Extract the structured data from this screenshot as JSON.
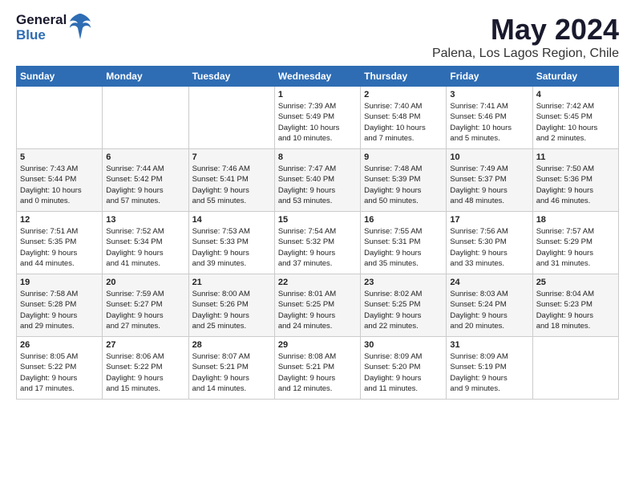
{
  "logo": {
    "line1": "General",
    "line2": "Blue"
  },
  "title": "May 2024",
  "subtitle": "Palena, Los Lagos Region, Chile",
  "days_header": [
    "Sunday",
    "Monday",
    "Tuesday",
    "Wednesday",
    "Thursday",
    "Friday",
    "Saturday"
  ],
  "weeks": [
    [
      {
        "day": "",
        "info": ""
      },
      {
        "day": "",
        "info": ""
      },
      {
        "day": "",
        "info": ""
      },
      {
        "day": "1",
        "info": "Sunrise: 7:39 AM\nSunset: 5:49 PM\nDaylight: 10 hours\nand 10 minutes."
      },
      {
        "day": "2",
        "info": "Sunrise: 7:40 AM\nSunset: 5:48 PM\nDaylight: 10 hours\nand 7 minutes."
      },
      {
        "day": "3",
        "info": "Sunrise: 7:41 AM\nSunset: 5:46 PM\nDaylight: 10 hours\nand 5 minutes."
      },
      {
        "day": "4",
        "info": "Sunrise: 7:42 AM\nSunset: 5:45 PM\nDaylight: 10 hours\nand 2 minutes."
      }
    ],
    [
      {
        "day": "5",
        "info": "Sunrise: 7:43 AM\nSunset: 5:44 PM\nDaylight: 10 hours\nand 0 minutes."
      },
      {
        "day": "6",
        "info": "Sunrise: 7:44 AM\nSunset: 5:42 PM\nDaylight: 9 hours\nand 57 minutes."
      },
      {
        "day": "7",
        "info": "Sunrise: 7:46 AM\nSunset: 5:41 PM\nDaylight: 9 hours\nand 55 minutes."
      },
      {
        "day": "8",
        "info": "Sunrise: 7:47 AM\nSunset: 5:40 PM\nDaylight: 9 hours\nand 53 minutes."
      },
      {
        "day": "9",
        "info": "Sunrise: 7:48 AM\nSunset: 5:39 PM\nDaylight: 9 hours\nand 50 minutes."
      },
      {
        "day": "10",
        "info": "Sunrise: 7:49 AM\nSunset: 5:37 PM\nDaylight: 9 hours\nand 48 minutes."
      },
      {
        "day": "11",
        "info": "Sunrise: 7:50 AM\nSunset: 5:36 PM\nDaylight: 9 hours\nand 46 minutes."
      }
    ],
    [
      {
        "day": "12",
        "info": "Sunrise: 7:51 AM\nSunset: 5:35 PM\nDaylight: 9 hours\nand 44 minutes."
      },
      {
        "day": "13",
        "info": "Sunrise: 7:52 AM\nSunset: 5:34 PM\nDaylight: 9 hours\nand 41 minutes."
      },
      {
        "day": "14",
        "info": "Sunrise: 7:53 AM\nSunset: 5:33 PM\nDaylight: 9 hours\nand 39 minutes."
      },
      {
        "day": "15",
        "info": "Sunrise: 7:54 AM\nSunset: 5:32 PM\nDaylight: 9 hours\nand 37 minutes."
      },
      {
        "day": "16",
        "info": "Sunrise: 7:55 AM\nSunset: 5:31 PM\nDaylight: 9 hours\nand 35 minutes."
      },
      {
        "day": "17",
        "info": "Sunrise: 7:56 AM\nSunset: 5:30 PM\nDaylight: 9 hours\nand 33 minutes."
      },
      {
        "day": "18",
        "info": "Sunrise: 7:57 AM\nSunset: 5:29 PM\nDaylight: 9 hours\nand 31 minutes."
      }
    ],
    [
      {
        "day": "19",
        "info": "Sunrise: 7:58 AM\nSunset: 5:28 PM\nDaylight: 9 hours\nand 29 minutes."
      },
      {
        "day": "20",
        "info": "Sunrise: 7:59 AM\nSunset: 5:27 PM\nDaylight: 9 hours\nand 27 minutes."
      },
      {
        "day": "21",
        "info": "Sunrise: 8:00 AM\nSunset: 5:26 PM\nDaylight: 9 hours\nand 25 minutes."
      },
      {
        "day": "22",
        "info": "Sunrise: 8:01 AM\nSunset: 5:25 PM\nDaylight: 9 hours\nand 24 minutes."
      },
      {
        "day": "23",
        "info": "Sunrise: 8:02 AM\nSunset: 5:25 PM\nDaylight: 9 hours\nand 22 minutes."
      },
      {
        "day": "24",
        "info": "Sunrise: 8:03 AM\nSunset: 5:24 PM\nDaylight: 9 hours\nand 20 minutes."
      },
      {
        "day": "25",
        "info": "Sunrise: 8:04 AM\nSunset: 5:23 PM\nDaylight: 9 hours\nand 18 minutes."
      }
    ],
    [
      {
        "day": "26",
        "info": "Sunrise: 8:05 AM\nSunset: 5:22 PM\nDaylight: 9 hours\nand 17 minutes."
      },
      {
        "day": "27",
        "info": "Sunrise: 8:06 AM\nSunset: 5:22 PM\nDaylight: 9 hours\nand 15 minutes."
      },
      {
        "day": "28",
        "info": "Sunrise: 8:07 AM\nSunset: 5:21 PM\nDaylight: 9 hours\nand 14 minutes."
      },
      {
        "day": "29",
        "info": "Sunrise: 8:08 AM\nSunset: 5:21 PM\nDaylight: 9 hours\nand 12 minutes."
      },
      {
        "day": "30",
        "info": "Sunrise: 8:09 AM\nSunset: 5:20 PM\nDaylight: 9 hours\nand 11 minutes."
      },
      {
        "day": "31",
        "info": "Sunrise: 8:09 AM\nSunset: 5:19 PM\nDaylight: 9 hours\nand 9 minutes."
      },
      {
        "day": "",
        "info": ""
      }
    ]
  ]
}
